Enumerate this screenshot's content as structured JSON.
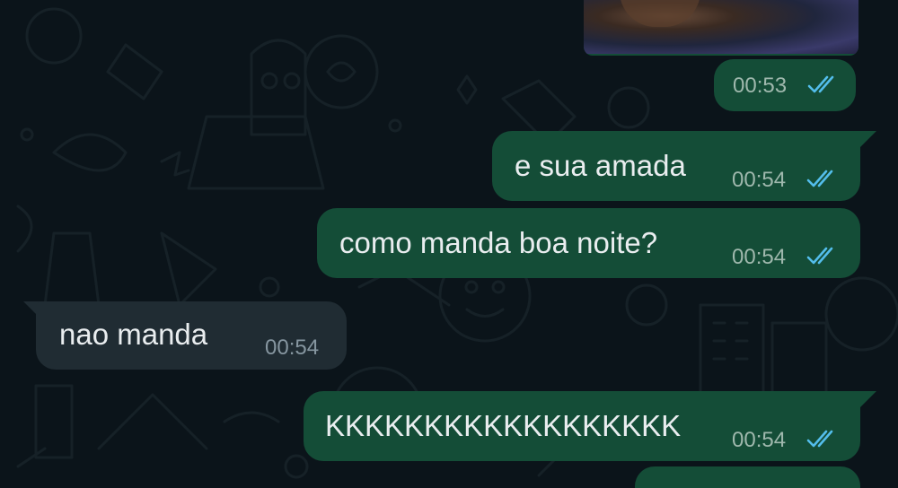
{
  "colors": {
    "background": "#0b141a",
    "outgoing_bubble": "#144d37",
    "incoming_bubble": "#202c33",
    "read_ticks": "#53bdeb",
    "message_text": "#e9edef"
  },
  "messages": [
    {
      "direction": "outgoing",
      "type": "image",
      "time": "00:53",
      "status": "read"
    },
    {
      "direction": "outgoing",
      "text": "e sua amada",
      "time": "00:54",
      "status": "read"
    },
    {
      "direction": "outgoing",
      "text": "como manda boa noite?",
      "time": "00:54",
      "status": "read"
    },
    {
      "direction": "incoming",
      "text": "nao manda",
      "time": "00:54"
    },
    {
      "direction": "outgoing",
      "text": "KKKKKKKKKKKKKKKKKK",
      "time": "00:54",
      "status": "read"
    }
  ]
}
